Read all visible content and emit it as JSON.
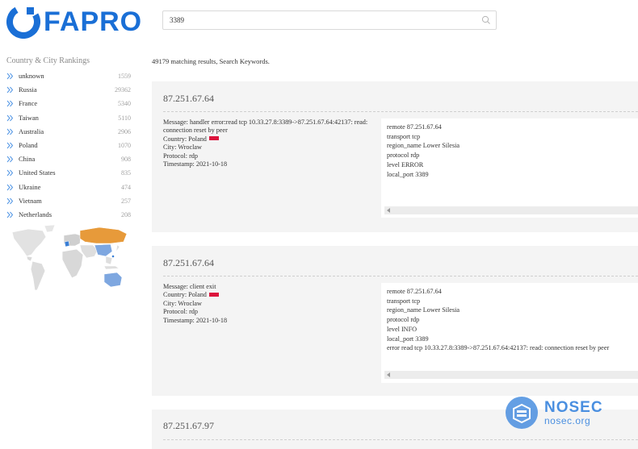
{
  "brand": {
    "name": "FAPRO",
    "color": "#1a6fd6"
  },
  "search": {
    "value": "3389",
    "icon": "search-icon"
  },
  "sidebar": {
    "title": "Country & City Rankings",
    "items": [
      {
        "label": "unknown",
        "count": "1559"
      },
      {
        "label": "Russia",
        "count": "29362"
      },
      {
        "label": "France",
        "count": "5340"
      },
      {
        "label": "Taiwan",
        "count": "5110"
      },
      {
        "label": "Australia",
        "count": "2906"
      },
      {
        "label": "Poland",
        "count": "1070"
      },
      {
        "label": "China",
        "count": "908"
      },
      {
        "label": "United States",
        "count": "835"
      },
      {
        "label": "Ukraine",
        "count": "474"
      },
      {
        "label": "Vietnam",
        "count": "257"
      },
      {
        "label": "Netherlands",
        "count": "208"
      }
    ]
  },
  "results": {
    "summary": "49179 matching results, Search Keywords.",
    "cards": [
      {
        "ip": "87.251.67.64",
        "message": "Message: handler error:read tcp 10.33.27.8:3389->87.251.67.64:42137: read: connection reset by peer",
        "country": "Country: Poland",
        "city": "City: Wroclaw",
        "protocol": "Protocol: rdp",
        "timestamp": "Timestamp: 2021-10-18",
        "raw": [
          "remote 87.251.67.64",
          "transport tcp",
          "region_name Lower Silesia",
          "protocol rdp",
          "level ERROR",
          "local_port 3389"
        ]
      },
      {
        "ip": "87.251.67.64",
        "message": "Message: client exit",
        "country": "Country: Poland",
        "city": "City: Wroclaw",
        "protocol": "Protocol: rdp",
        "timestamp": "Timestamp: 2021-10-18",
        "raw": [
          "remote 87.251.67.64",
          "transport tcp",
          "region_name Lower Silesia",
          "protocol rdp",
          "level INFO",
          "local_port 3389",
          "error read tcp 10.33.27.8:3389->87.251.67.64:42137: read: connection reset by peer"
        ]
      },
      {
        "ip": "87.251.67.97"
      }
    ]
  },
  "watermark": {
    "name": "NOSEC",
    "site": "nosec.org",
    "color": "#4a8fe0"
  }
}
